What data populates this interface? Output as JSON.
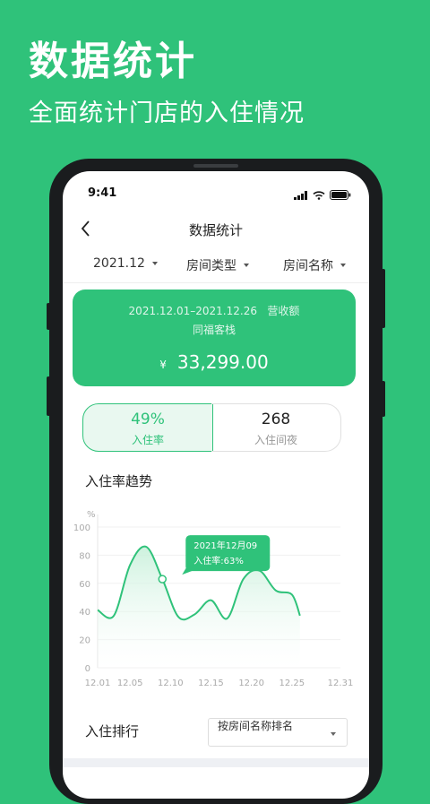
{
  "hero": {
    "title": "数据统计",
    "subtitle": "全面统计门店的入住情况"
  },
  "status_bar": {
    "time": "9:41"
  },
  "nav": {
    "title": "数据统计"
  },
  "filters": {
    "month": "2021.12",
    "room_type": "房间类型",
    "room_name": "房间名称"
  },
  "revenue": {
    "period": "2021.12.01–2021.12.26",
    "label": "营收额",
    "store": "同福客栈",
    "currency": "¥",
    "amount": "33,299.00"
  },
  "stats": {
    "occupancy_value": "49%",
    "occupancy_label": "入住率",
    "nights_value": "268",
    "nights_label": "入住间夜"
  },
  "trend": {
    "title": "入住率趋势"
  },
  "chart_data": {
    "type": "area",
    "ylabel": "%",
    "ylim": [
      0,
      100
    ],
    "yticks": [
      0,
      20,
      40,
      60,
      80,
      100
    ],
    "xticks": [
      "12.01",
      "12.05",
      "12.10",
      "12.15",
      "12.20",
      "12.25",
      "12.31"
    ],
    "series": [
      {
        "x": [
          "12.01",
          "12.03",
          "12.05",
          "12.07",
          "12.09",
          "12.11",
          "12.13",
          "12.15",
          "12.17",
          "12.19",
          "12.21",
          "12.23",
          "12.25",
          "12.26"
        ],
        "values": [
          41,
          37,
          73,
          86,
          63,
          36,
          38,
          48,
          35,
          63,
          69,
          55,
          52,
          37
        ]
      }
    ],
    "tooltip": {
      "date": "2021年12月09",
      "text": "入住率:63%"
    },
    "colors": {
      "line": "#2fc27a",
      "fill_top": "#c7f0da",
      "grid": "#f0f0f0",
      "axis_text": "#aaa"
    }
  },
  "ranking": {
    "title": "入住排行",
    "sort_select": "按房间名称排名"
  },
  "colors": {
    "accent": "#2fc27a",
    "text": "#222222",
    "muted": "#999999"
  }
}
